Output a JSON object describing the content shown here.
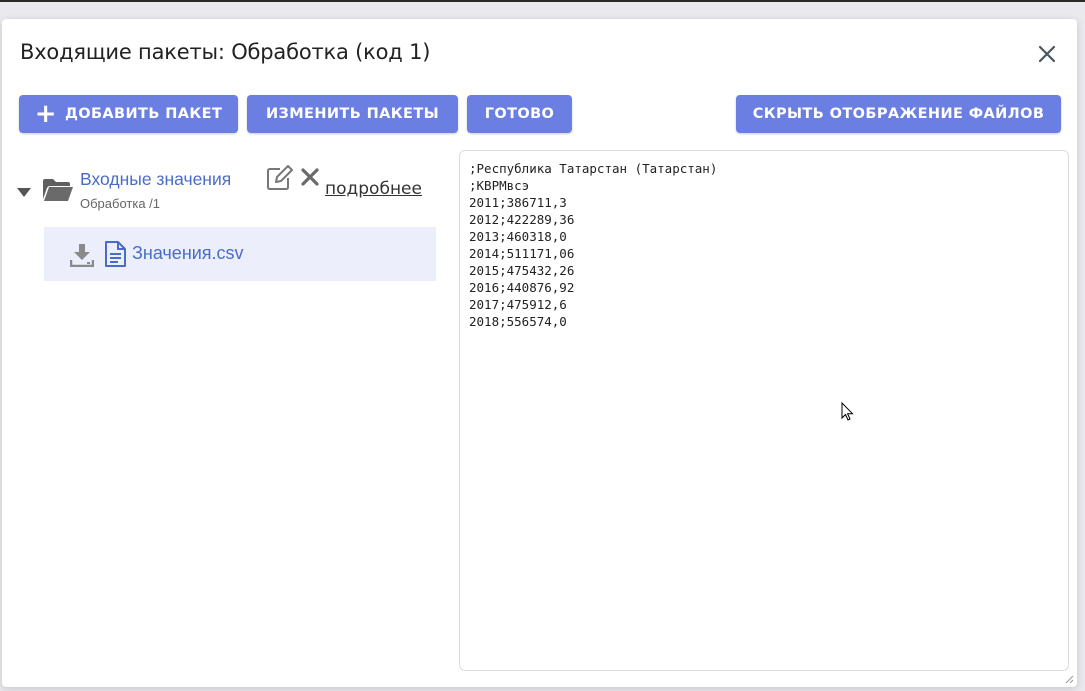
{
  "dialog": {
    "title": "Входящие пакеты: Обработка (код 1)"
  },
  "toolbar": {
    "add_label": "ДОБАВИТЬ ПАКЕТ",
    "edit_label": "ИЗМЕНИТЬ ПАКЕТЫ",
    "done_label": "ГОТОВО",
    "hide_files_label": "СКРЫТЬ ОТОБРАЖЕНИЕ ФАЙЛОВ"
  },
  "tree": {
    "node": {
      "name": "Входные значения",
      "subtitle": "Обработка /1",
      "more_label": "подробнее"
    },
    "files": [
      {
        "name": "Значения.csv"
      }
    ]
  },
  "viewer": {
    "content": ";Республика Татарстан (Татарстан)\n;КВРМвсэ\n2011;386711,3\n2012;422289,36\n2013;460318,0\n2014;511171,06\n2015;475432,26\n2016;440876,92\n2017;475912,6\n2018;556574,0"
  },
  "colors": {
    "accent": "#6b7fe3",
    "link": "#4a6cc9",
    "selected_row": "#eceffb"
  },
  "icons": {
    "close": "close-icon",
    "caret": "caret-down-icon",
    "folder": "folder-open-icon",
    "edit": "pencil-square-icon",
    "delete": "x-icon",
    "download": "download-icon",
    "file": "file-text-icon",
    "add": "plus-icon"
  }
}
